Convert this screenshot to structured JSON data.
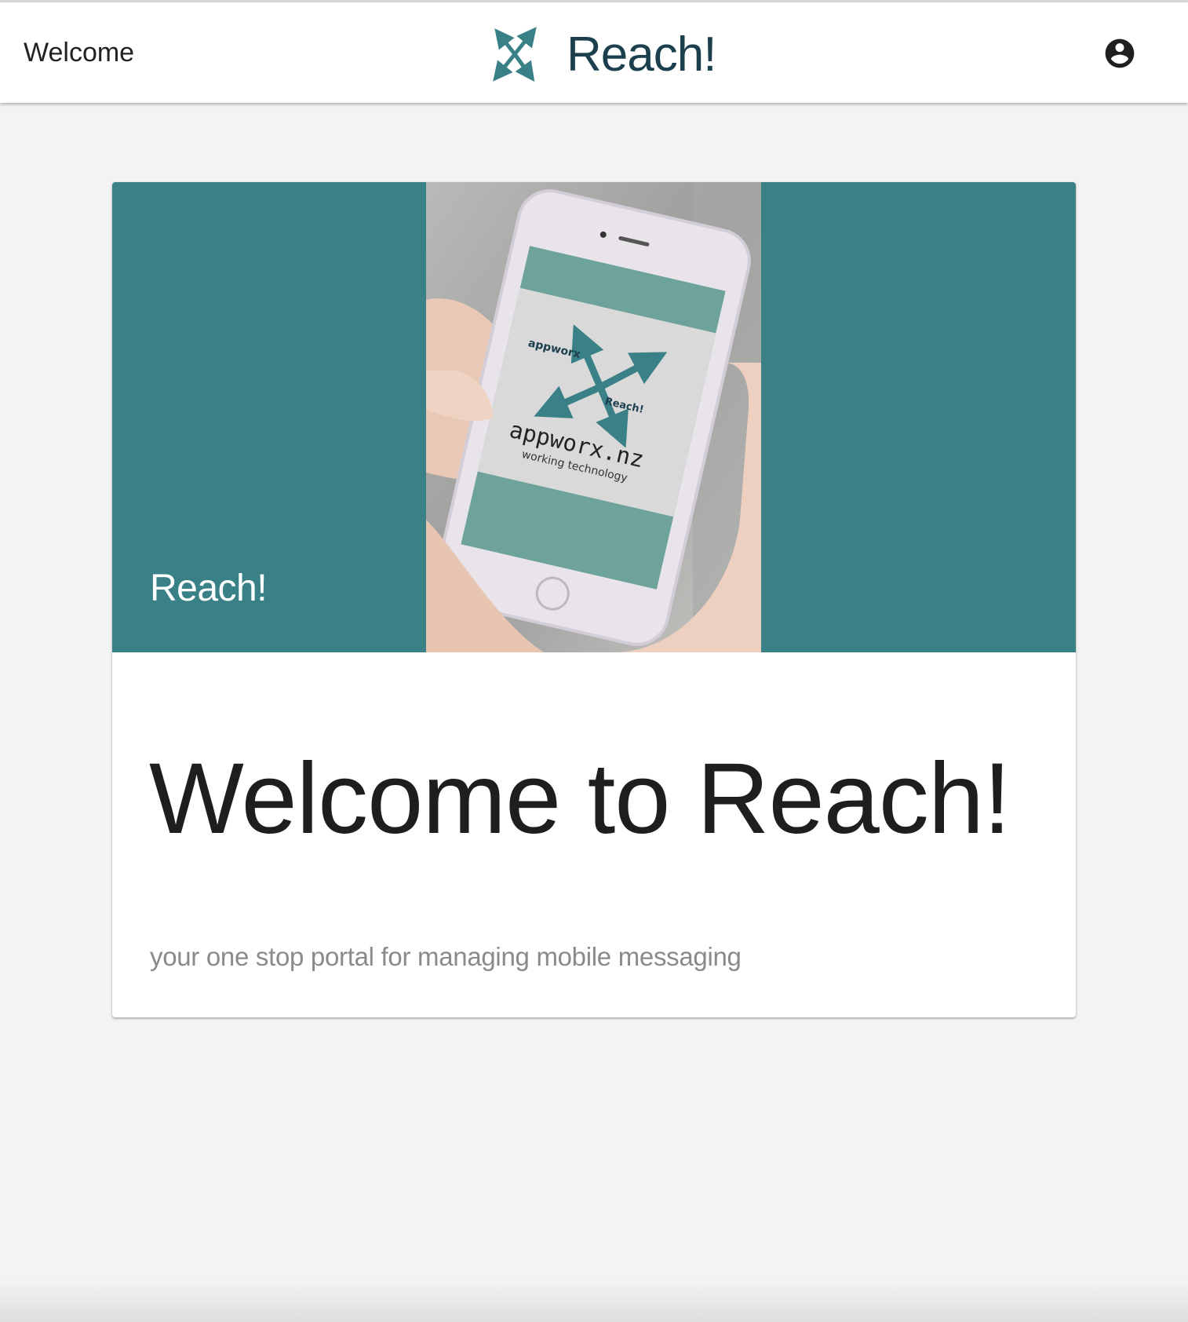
{
  "header": {
    "title": "Welcome",
    "brand_name": "Reach!",
    "brand_logo_icon": "reach-arrows-logo-icon",
    "account_icon": "account-circle-icon"
  },
  "card": {
    "media_title": "Reach!",
    "photo_alt": "Hand holding phone showing appworx Reach! logo",
    "photo_text": {
      "logo_left": "appworx",
      "logo_right": "Reach!",
      "domain": "appworx.nz",
      "tagline": "working technology"
    },
    "heading": "Welcome to Reach!",
    "subtitle": "your one stop portal for managing mobile messaging"
  },
  "colors": {
    "background": "#f3f3f3",
    "header_bg": "#ffffff",
    "brand_text": "#1c3f4e",
    "teal_banner": "#3a8087",
    "logo_teal": "#3a8087",
    "heading_text": "#1e1e1e",
    "subtitle_text": "#8a8a8a"
  }
}
